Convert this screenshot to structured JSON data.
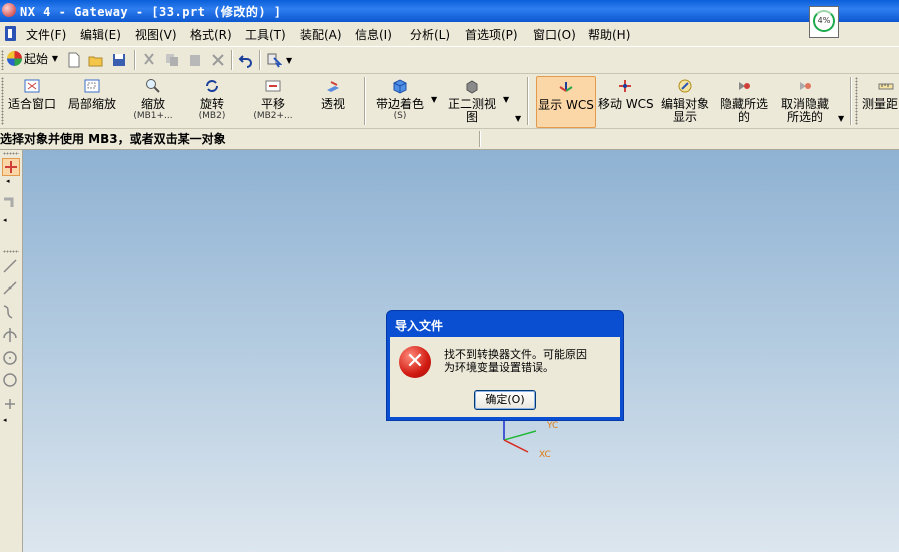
{
  "window": {
    "title": "NX 4 - Gateway - [33.prt  (修改的) ]"
  },
  "progress": {
    "percent": "4%",
    "value": 0.04
  },
  "menu": [
    {
      "label": "文件(F)"
    },
    {
      "label": "编辑(E)"
    },
    {
      "label": "视图(V)"
    },
    {
      "label": "格式(R)"
    },
    {
      "label": "工具(T)"
    },
    {
      "label": "装配(A)"
    },
    {
      "label": "信息(I)"
    },
    {
      "label": "分析(L)"
    },
    {
      "label": "首选项(P)"
    },
    {
      "label": "窗口(O)"
    },
    {
      "label": "帮助(H)"
    }
  ],
  "toolbar_std": {
    "start_label": "起始"
  },
  "toolbar_view": [
    {
      "label": "适合窗口",
      "sub": "",
      "icon": "fit-window-icon"
    },
    {
      "label": "局部缩放",
      "sub": "",
      "icon": "zoom-region-icon"
    },
    {
      "label": "缩放",
      "sub": "(MB1+...",
      "icon": "zoom-icon"
    },
    {
      "label": "旋转",
      "sub": "(MB2)",
      "icon": "rotate-icon"
    },
    {
      "label": "平移",
      "sub": "(MB2+...",
      "icon": "pan-icon"
    },
    {
      "label": "透视",
      "sub": "",
      "icon": "perspective-icon"
    },
    {
      "label": "带边着色",
      "sub": "(S)",
      "icon": "shaded-edges-icon"
    },
    {
      "label": "正二测视",
      "sub": "图",
      "icon": "trimetric-view-icon"
    },
    {
      "label": "显示 WCS",
      "sub": "",
      "icon": "display-wcs-icon"
    },
    {
      "label": "移动 WCS",
      "sub": "",
      "icon": "move-wcs-icon"
    },
    {
      "label": "编辑对象",
      "sub": "显示",
      "icon": "edit-object-display-icon"
    },
    {
      "label": "隐藏所选",
      "sub": "的",
      "icon": "hide-selected-icon"
    },
    {
      "label": "取消隐藏",
      "sub": "所选的",
      "icon": "unhide-selected-icon"
    },
    {
      "label": "测量距",
      "sub": "",
      "icon": "measure-distance-icon"
    }
  ],
  "status": {
    "message": "选择对象并使用 MB3，或者双击某一对象"
  },
  "dialog": {
    "title": "导入文件",
    "message_line1": "找不到转换器文件。可能原因",
    "message_line2": "为环境变量设置错误。",
    "ok_label": "确定(O)"
  },
  "wcs": {
    "x_label": "XC",
    "y_label": "YC"
  },
  "colors": {
    "title_bar": "#0a5fd9",
    "dialog_title": "#0a4ed2",
    "viewport_top": "#8fb2d3",
    "viewport_bottom": "#dde6ee",
    "active_button": "#fbd7a8"
  }
}
